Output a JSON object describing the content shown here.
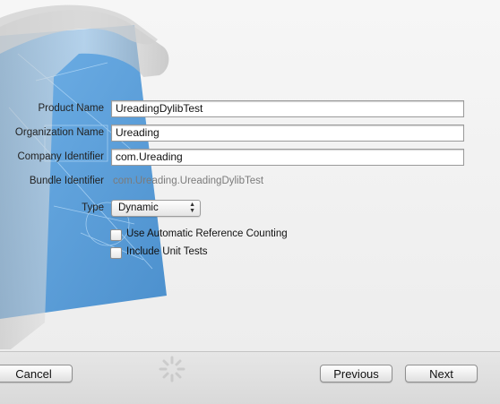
{
  "form": {
    "product_name": {
      "label": "Product Name",
      "value": "UreadingDylibTest"
    },
    "organization_name": {
      "label": "Organization Name",
      "value": "Ureading"
    },
    "company_identifier": {
      "label": "Company Identifier",
      "value": "com.Ureading"
    },
    "bundle_identifier": {
      "label": "Bundle Identifier",
      "value": "com.Ureading.UreadingDylibTest"
    },
    "type": {
      "label": "Type",
      "selected": "Dynamic"
    },
    "arc": {
      "label": "Use Automatic Reference Counting",
      "checked": false
    },
    "unit_tests": {
      "label": "Include Unit Tests",
      "checked": false
    }
  },
  "footer": {
    "cancel_label": "Cancel",
    "previous_label": "Previous",
    "next_label": "Next"
  },
  "colors": {
    "blueprint": "#3d8fd4",
    "accent_text": "#7b7b7b"
  },
  "icons": [
    "xcode-hammer-icon",
    "blueprint-icon",
    "chevron-updown-icon",
    "spinner-icon"
  ]
}
